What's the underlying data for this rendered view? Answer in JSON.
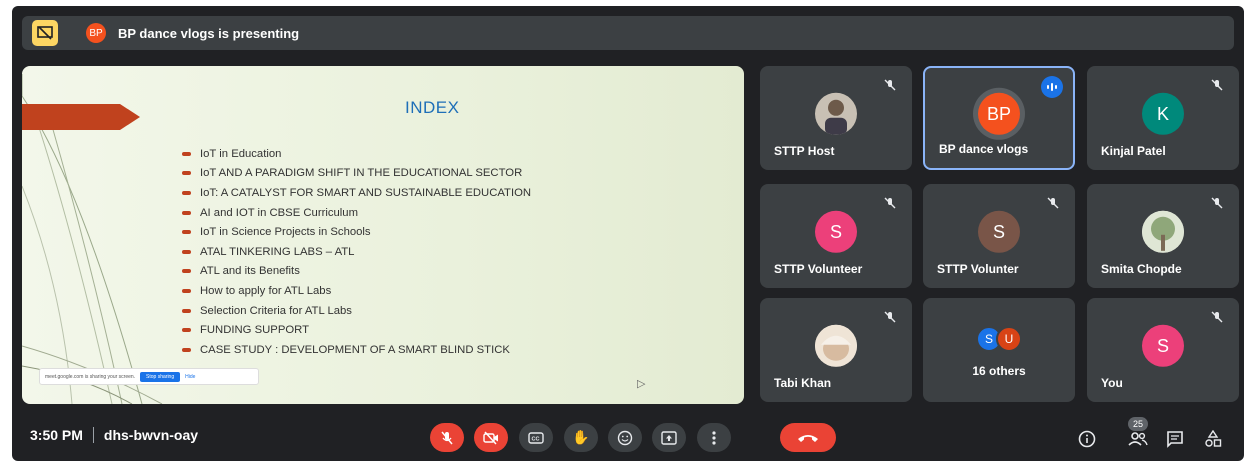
{
  "presenting": {
    "avatar_initials": "BP",
    "text": "BP dance vlogs is presenting"
  },
  "slide": {
    "title": "INDEX",
    "bullets": [
      "IoT in Education",
      "IoT AND A PARADIGM SHIFT IN THE EDUCATIONAL SECTOR",
      "IoT: A CATALYST FOR SMART AND SUSTAINABLE EDUCATION",
      "AI and IOT in CBSE Curriculum",
      "IoT in Science Projects in Schools",
      "ATAL TINKERING LABS – ATL",
      "ATL and its Benefits",
      "How to apply for ATL Labs",
      "Selection Criteria for ATL Labs",
      "FUNDING SUPPORT",
      "CASE STUDY :  DEVELOPMENT OF A SMART BLIND STICK"
    ],
    "share_notice": {
      "text": "meet.google.com is sharing your screen.",
      "stop": "Stop sharing",
      "hide": "Hide"
    }
  },
  "participants": [
    {
      "name": "STTP Host",
      "type": "photo",
      "muted": true
    },
    {
      "name": "BP dance vlogs",
      "initials": "BP",
      "color": "#f4511e",
      "speaking": true
    },
    {
      "name": "Kinjal Patel",
      "initials": "K",
      "color": "#00897b",
      "muted": true
    },
    {
      "name": "STTP Volunteer",
      "initials": "S",
      "color": "#ec407a",
      "muted": true
    },
    {
      "name": "STTP Volunter",
      "initials": "S",
      "color": "#795548",
      "muted": true
    },
    {
      "name": "Smita Chopde",
      "type": "photo",
      "muted": true
    },
    {
      "name": "Tabi Khan",
      "type": "photo",
      "muted": true
    },
    {
      "others_initials": [
        "S",
        "U"
      ],
      "others_colors": [
        "#1a73e8",
        "#d84315"
      ],
      "label": "16 others"
    },
    {
      "name": "You",
      "initials": "S",
      "color": "#ec407a",
      "muted": true
    }
  ],
  "footer": {
    "time": "3:50 PM",
    "meeting_code": "dhs-bwvn-oay",
    "people_count": "25"
  },
  "controls": [
    "mic-off-icon",
    "camera-off-icon",
    "captions-icon",
    "raise-hand-icon",
    "emoji-icon",
    "present-icon",
    "more-icon",
    "hang-up-icon"
  ]
}
